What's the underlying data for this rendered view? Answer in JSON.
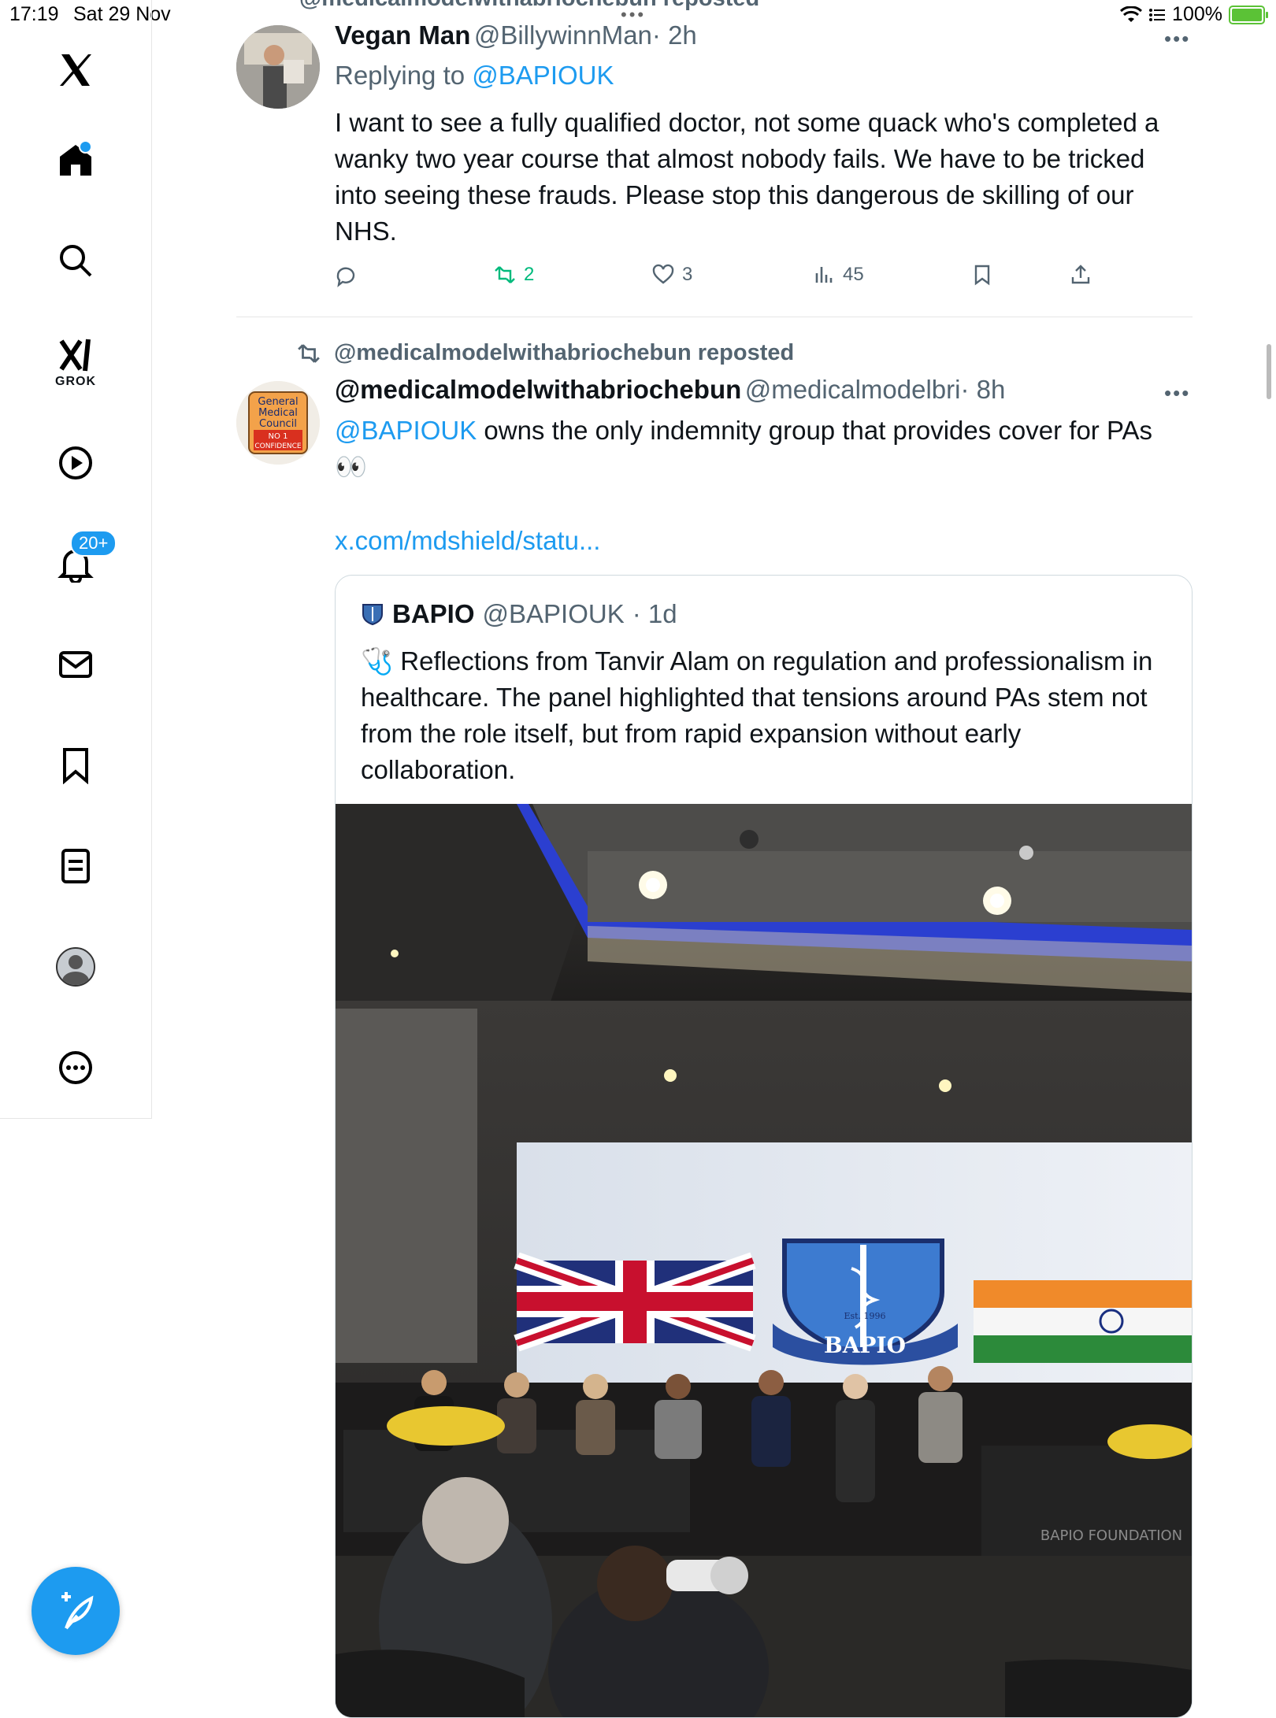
{
  "status_bar": {
    "time": "17:19",
    "date": "Sat 29 Nov",
    "battery_percent": "100%",
    "battery_level": 1.0
  },
  "sidebar": {
    "grok_label": "GROK",
    "notifications_badge": "20+",
    "items": [
      "x-logo",
      "home",
      "search",
      "grok",
      "video",
      "notifications",
      "messages",
      "bookmarks",
      "lists",
      "profile",
      "more"
    ]
  },
  "top_repost": {
    "text": "@medicalmodelwithabriochebun reposted"
  },
  "reply_post": {
    "name": "Vegan Man",
    "handle": "@BillywinnMan",
    "time": "· 2h",
    "replying_prefix": "Replying to",
    "replying_to": "@BAPIOUK",
    "body": "I want to see a fully qualified doctor, not some quack who's completed a wanky two year course that almost nobody fails. We have to be tricked into seeing these frauds. Please stop this dangerous de skilling of our NHS.",
    "actions": {
      "replies": "",
      "reposts": "2",
      "likes": "3",
      "views": "45"
    }
  },
  "quote_post": {
    "repost_label": "@medicalmodelwithabriochebun reposted",
    "name": "@medicalmodelwithabriochebun",
    "handle": "@medicalmodelbri",
    "time": "· 8h",
    "mention": "@BAPIOUK",
    "body": " owns the only indemnity group that provides cover for PAs",
    "emoji": "👀",
    "link": "x.com/mdshield/statu...",
    "avatar_text": [
      "General",
      "Medical",
      "Council",
      "NO 1",
      "CONFIDENCE"
    ],
    "quoted": {
      "name": "BAPIO",
      "handle": "@BAPIOUK",
      "time": "· 1d",
      "emoji": "🩺",
      "body": "Reflections from Tanvir Alam on regulation and professionalism in healthcare. The panel highlighted that tensions around PAs stem not from the role itself, but from rapid expansion without early collaboration.",
      "photo": {
        "logo_text": "BAPIO",
        "est_text": "Est. 1996",
        "table_text": "BAPIO FOUNDATION"
      }
    }
  },
  "colors": {
    "accent": "#1d9bf0",
    "repost_green": "#00ba7c",
    "muted": "#536471"
  }
}
